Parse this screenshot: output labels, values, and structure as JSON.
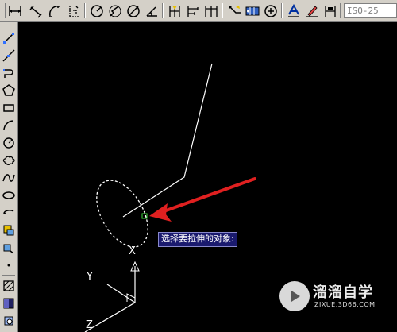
{
  "toolbar": {
    "dim_style_value": "ISO-25",
    "top_icons": [
      "linear-dimension-icon",
      "aligned-dimension-icon",
      "arc-length-icon",
      "ordinate-dimension-icon",
      "radius-dimension-icon",
      "jogged-dimension-icon",
      "diameter-dimension-icon",
      "angular-dimension-icon",
      "quick-dimension-icon",
      "baseline-dimension-icon",
      "continue-dimension-icon",
      "quick-leader-icon",
      "tolerance-icon",
      "center-mark-icon",
      "dimension-edit-icon",
      "dimension-text-edit-icon",
      "dimension-update-icon"
    ],
    "left_icons": [
      "line-icon",
      "construction-line-icon",
      "polyline-icon",
      "polygon-icon",
      "rectangle-icon",
      "arc-icon",
      "circle-icon",
      "revision-cloud-icon",
      "spline-icon",
      "ellipse-icon",
      "ellipse-arc-icon",
      "insert-block-icon",
      "make-block-icon",
      "point-icon",
      "hatch-icon",
      "gradient-icon",
      "region-icon"
    ]
  },
  "command_prompt": {
    "text": "选择要拉伸的对象:"
  },
  "ucs": {
    "y_label": "Y",
    "x_label": "X",
    "z_label": "Z"
  },
  "watermark": {
    "title": "溜溜自学",
    "subtitle": "ZIXUE.3D66.COM"
  },
  "colors": {
    "background": "#000000",
    "toolbar": "#d4d0c8",
    "arrow": "#e02020",
    "prompt_bg": "#1a1a6e"
  }
}
